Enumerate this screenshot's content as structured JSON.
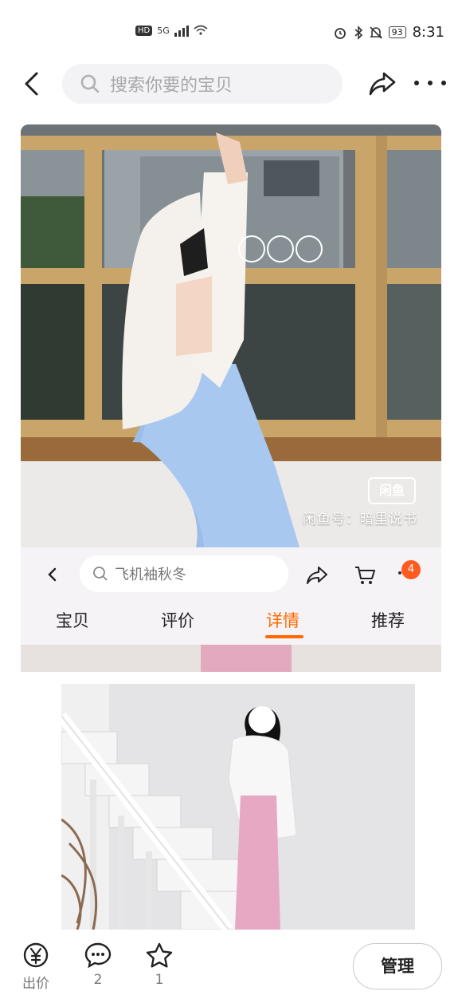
{
  "status_bar": {
    "hd": "HD",
    "network": "5G",
    "battery": "93",
    "time": "8:31"
  },
  "nav": {
    "search_placeholder": "搜索你要的宝贝"
  },
  "photo": {
    "brand": "闲鱼",
    "seller": "闲鱼号：暗里说书"
  },
  "inner": {
    "search_text": "飞机袖秋冬",
    "cart_badge": "4",
    "tabs": [
      "宝贝",
      "评价",
      "详情",
      "推荐"
    ],
    "active_tab": "详情"
  },
  "bottom": {
    "offer_label": "出价",
    "comment_count": "2",
    "favorite_count": "1",
    "manage_label": "管理"
  },
  "colors": {
    "accent": "#ff6a00",
    "badge": "#ff5a1f"
  },
  "icons": [
    "back-icon",
    "search-icon",
    "share-icon",
    "more-icon",
    "cart-icon",
    "yuan-offer-icon",
    "comment-icon",
    "star-icon"
  ]
}
